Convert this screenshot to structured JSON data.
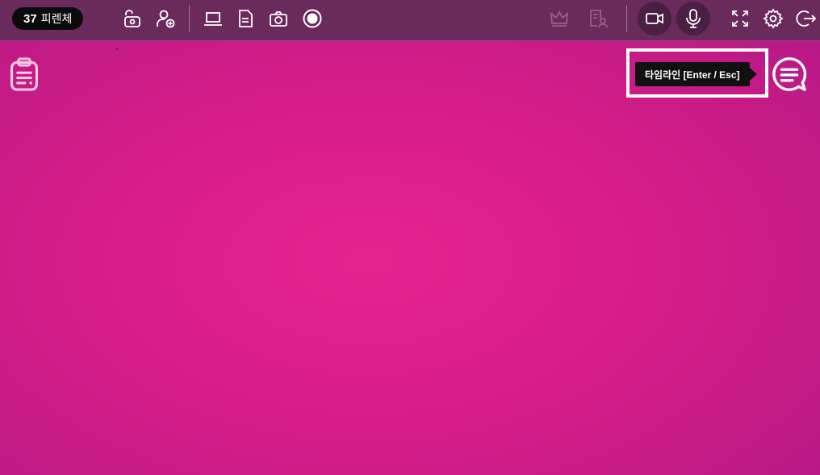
{
  "room": {
    "count": "37",
    "name": "피렌체"
  },
  "toolbar": {
    "left_icons": [
      "lock-open-icon",
      "add-user-icon",
      "laptop-icon",
      "document-icon",
      "camera-icon",
      "record-icon"
    ],
    "right_icons": [
      "crown-icon",
      "profile-doc-icon",
      "video-camera-icon",
      "microphone-icon",
      "fullscreen-icon",
      "gear-icon",
      "logout-icon"
    ]
  },
  "tooltip": {
    "text": "타임라인 [Enter / Esc]"
  },
  "side": {
    "memo_icon": "clipboard-icon",
    "chat_icon": "chat-icon"
  },
  "colors": {
    "background": "#d61d88",
    "topbar": "#6a2a5c",
    "icon": "#ffffff",
    "tooltip_bg": "#111111"
  }
}
